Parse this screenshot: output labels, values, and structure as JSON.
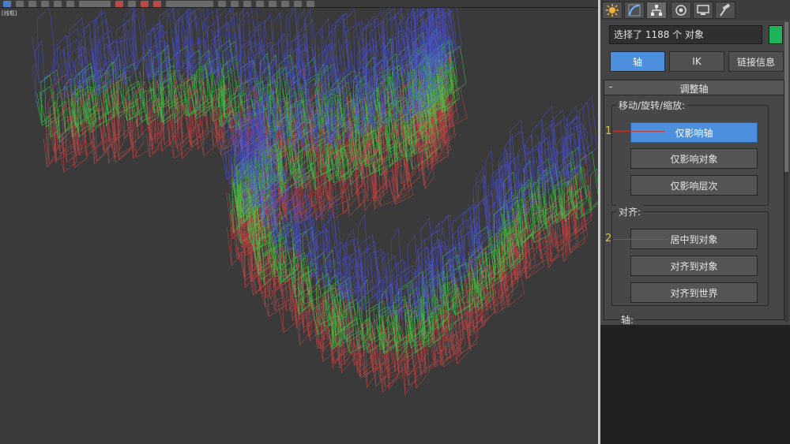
{
  "viewport": {
    "label": "[线框]"
  },
  "panel": {
    "tabs": [
      {
        "icon": "sun-icon"
      },
      {
        "icon": "curve-icon"
      },
      {
        "icon": "hierarchy-icon"
      },
      {
        "icon": "motion-icon"
      },
      {
        "icon": "monitor-icon"
      },
      {
        "icon": "hammer-icon"
      }
    ],
    "selection_text": "选择了 1188 个 对象",
    "swatch_color": "#1fb35a",
    "mode_buttons": [
      "轴",
      "IK",
      "链接信息"
    ],
    "rollout": {
      "toggle": "-",
      "title": "调整轴",
      "move_group": {
        "label": "移动/旋转/缩放:",
        "buttons": [
          "仅影响轴",
          "仅影响对象",
          "仅影响层次"
        ]
      },
      "align_group": {
        "label": "对齐:",
        "buttons": [
          "居中到对象",
          "对齐到对象",
          "对齐到世界"
        ]
      }
    },
    "next_rollout_label": "轴:",
    "steps": [
      "1",
      "2"
    ]
  },
  "colors": {
    "accent": "#4c8fdc",
    "wire_blue": "#4b50d8",
    "wire_green": "#3fd64a",
    "wire_red": "#d64545",
    "annotation_red": "#c13a3a",
    "annotation_yellow": "#d9c24a"
  }
}
